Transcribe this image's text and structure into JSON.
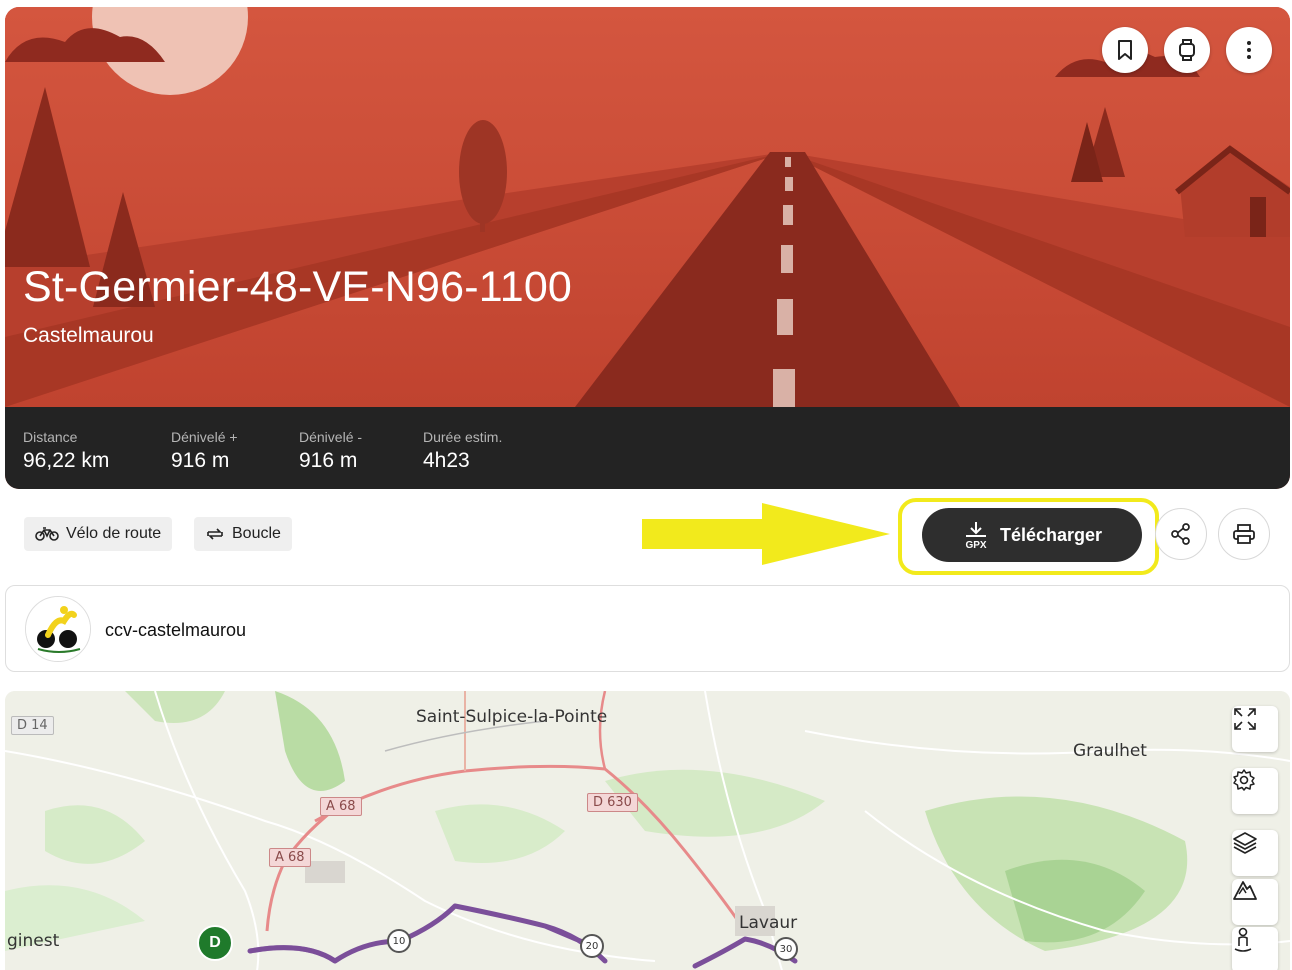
{
  "route": {
    "title": "St-Germier-48-VE-N96-1100",
    "location": "Castelmaurou"
  },
  "hero_actions": [
    {
      "icon": "bookmark-icon"
    },
    {
      "icon": "watch-icon"
    },
    {
      "icon": "more-vertical-icon"
    }
  ],
  "stats": {
    "distance": {
      "label": "Distance",
      "value": "96,22 km"
    },
    "elevation_gain": {
      "label": "Dénivelé +",
      "value": "916 m"
    },
    "elevation_loss": {
      "label": "Dénivelé -",
      "value": "916 m"
    },
    "duration": {
      "label": "Durée estim.",
      "value": "4h23"
    }
  },
  "tags": {
    "activity": {
      "label": "Vélo de route",
      "icon": "bike-icon"
    },
    "type": {
      "label": "Boucle",
      "icon": "loop-icon"
    }
  },
  "actions": {
    "download": {
      "label": "Télécharger",
      "icon_text": "GPX"
    },
    "share_icon": "share-icon",
    "print_icon": "print-icon"
  },
  "annotation": {
    "arrow_color": "#f2ea1c"
  },
  "author": {
    "name": "ccv-castelmaurou"
  },
  "map": {
    "places": {
      "saint_sulpice": "Saint-Sulpice-la-Pointe",
      "graulhet": "Graulhet",
      "lavaur": "Lavaur",
      "ginest": "ginest"
    },
    "roads": {
      "d14": "D 14",
      "a68_top": "A 68",
      "a68_bottom": "A 68",
      "d630": "D 630"
    },
    "km_markers": [
      "10",
      "20",
      "30"
    ],
    "start_label": "D",
    "controls": [
      "fullscreen-icon",
      "settings-icon",
      "layers-icon",
      "terrain-icon",
      "pegman-icon"
    ]
  },
  "colors": {
    "hero_red": "#c94a37",
    "stats_bg": "#232323",
    "route_purple": "#7b4f9a",
    "start_green": "#1f7a2b"
  }
}
